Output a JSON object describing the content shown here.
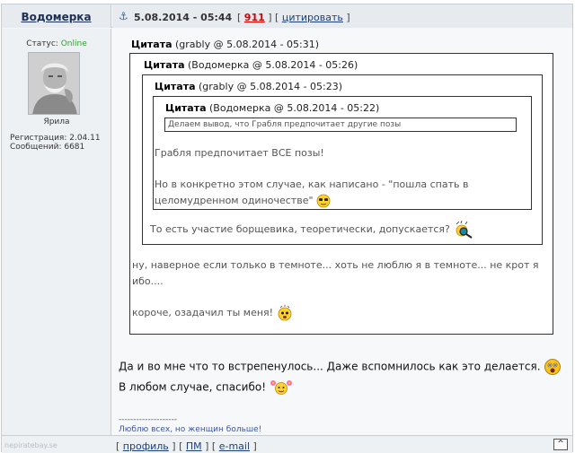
{
  "post": {
    "author": "Водомерка",
    "date": "5.08.2014 - 05:44",
    "number": "911",
    "quote_link": "цитировать"
  },
  "sidebar": {
    "status_label": "Статус:",
    "status_value": "Online",
    "avatar_name": "Ярила",
    "reg_label": "Регистрация: 2.04.11",
    "posts_label": "Сообщений: 6681"
  },
  "quotes": {
    "q1_label": "Цитата",
    "q1_meta": " (grably @ 5.08.2014 - 05:31)",
    "q2_label": "Цитата",
    "q2_meta": " (Водомерка @ 5.08.2014 - 05:26)",
    "q3_label": "Цитата",
    "q3_meta": " (grably @ 5.08.2014 - 05:23)",
    "q4_label": "Цитата",
    "q4_meta": " (Водомерка @ 5.08.2014 - 05:22)",
    "q4_text": "Делаем вывод, что Грабля предпочитает другие позы",
    "q3_line1": "Грабля предпочитает ВСЕ позы!",
    "q3_line2": "Но в конкретно этом случае, как написано - \"пошла спать в",
    "q3_line3": "целомудренном одиночестве\"",
    "q2_text": "То есть участие борщевика, теоретически, допускается?",
    "q1_line1": "ну, наверное если только в темноте... хоть не люблю я в темноте... не крот я",
    "q1_line2": "ибо....",
    "q1_line3": "короче, озадачил ты меня!"
  },
  "message": {
    "line1": "Да и во мне что то встрепенулось... Даже вспомнилось как это делается.",
    "line2": "В любом случае, спасибо!"
  },
  "signature": {
    "divider": "--------------------",
    "text": "Люблю всех, но женщин больше!"
  },
  "footer": {
    "watermark": "nepiratebay.se",
    "profile": "профиль",
    "pm": "ПМ",
    "email": "e-mail",
    "top": "^"
  },
  "colors": {
    "status_online": "#2e9e2e",
    "post_number": "#d40000",
    "signature": "#3b55a3"
  },
  "icons": [
    "anchor-icon",
    "sunglasses-smiley-icon",
    "magnifier-smiley-icon",
    "dizzy-smiley-icon",
    "shocked-smiley-icon",
    "flower-smiley-icon"
  ]
}
